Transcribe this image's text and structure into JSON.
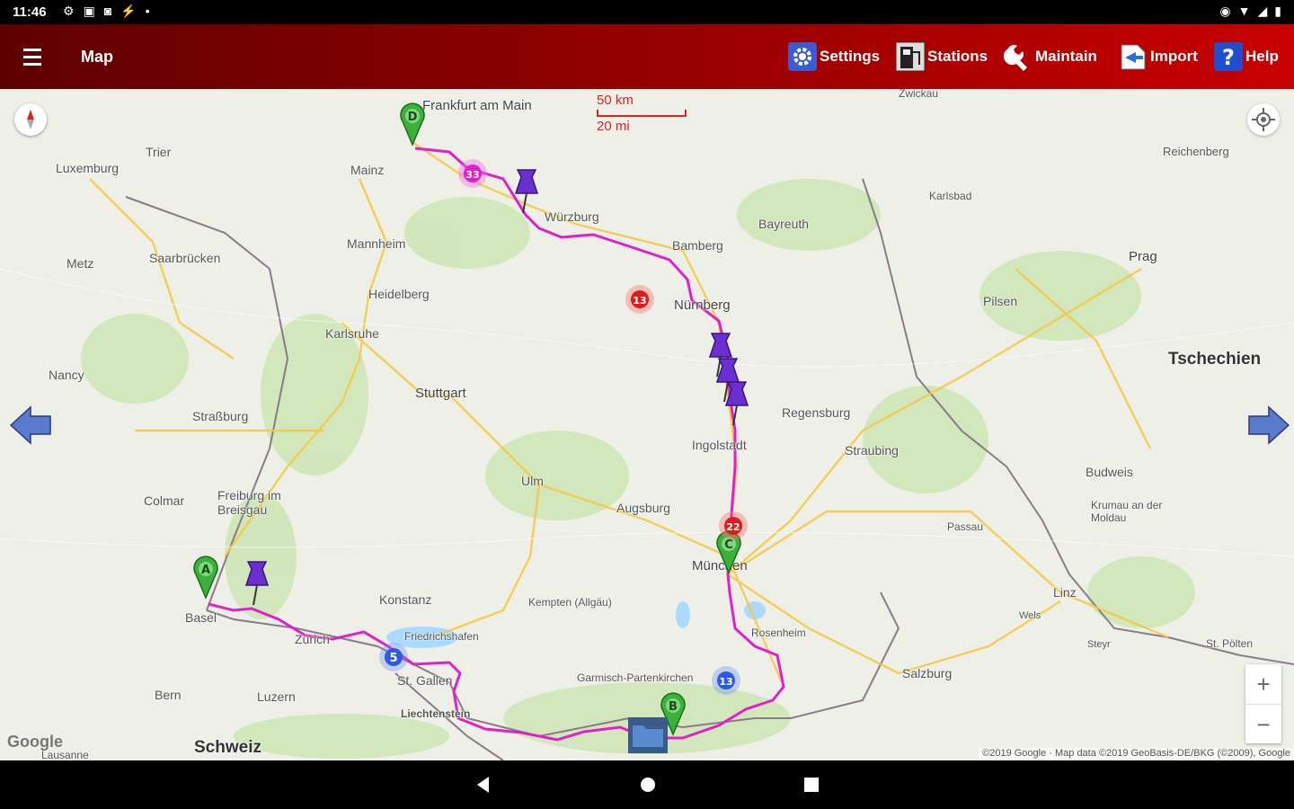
{
  "status": {
    "time": "11:46"
  },
  "toolbar": {
    "title": "Map",
    "buttons": [
      {
        "label": "Settings"
      },
      {
        "label": "Stations"
      },
      {
        "label": "Maintain"
      },
      {
        "label": "Import"
      },
      {
        "label": "Help"
      }
    ]
  },
  "map": {
    "scale_km": "50 km",
    "scale_mi": "20 mi",
    "country_labels": [
      "Tschechien",
      "Schweiz"
    ],
    "cities": [
      "Frankfurt am Main",
      "Mainz",
      "Trier",
      "Luxemburg",
      "Mannheim",
      "Saarbrücken",
      "Würzburg",
      "Bamberg",
      "Bayreuth",
      "Heidelberg",
      "Metz",
      "Karlsruhe",
      "Nürnberg",
      "Stuttgart",
      "Nancy",
      "Straßburg",
      "Regensburg",
      "Ingolstadt",
      "Straubing",
      "Ulm",
      "Colmar",
      "Freiburg im Breisgau",
      "Augsburg",
      "Basel",
      "Konstanz",
      "Kempten (Allgäu)",
      "München",
      "Zürich",
      "Friedrichshafen",
      "St. Gallen",
      "Liechtenstein",
      "Rosenheim",
      "Garmisch-Partenkirchen",
      "Bern",
      "Luzern",
      "Karlsbad",
      "Reichenberg",
      "Prag",
      "Pilsen",
      "Budweis",
      "Krumau an der Moldau",
      "Passau",
      "Linz",
      "Wels",
      "Steyr",
      "St. Pölten",
      "Salzburg",
      "Lausanne",
      "Zwickau"
    ],
    "markers": [
      {
        "label": "A"
      },
      {
        "label": "B"
      },
      {
        "label": "C"
      },
      {
        "label": "D"
      }
    ],
    "badges": [
      {
        "label": "5"
      },
      {
        "label": "13"
      },
      {
        "label": "33"
      },
      {
        "label": "13"
      },
      {
        "label": "22"
      }
    ],
    "google": "Google",
    "attribution": "©2019 Google · Map data ©2019 GeoBasis-DE/BKG (©2009), Google"
  },
  "colors": {
    "route": "#e020c8",
    "toolbar": "#9b0000",
    "pin": "#6a2fd0"
  }
}
